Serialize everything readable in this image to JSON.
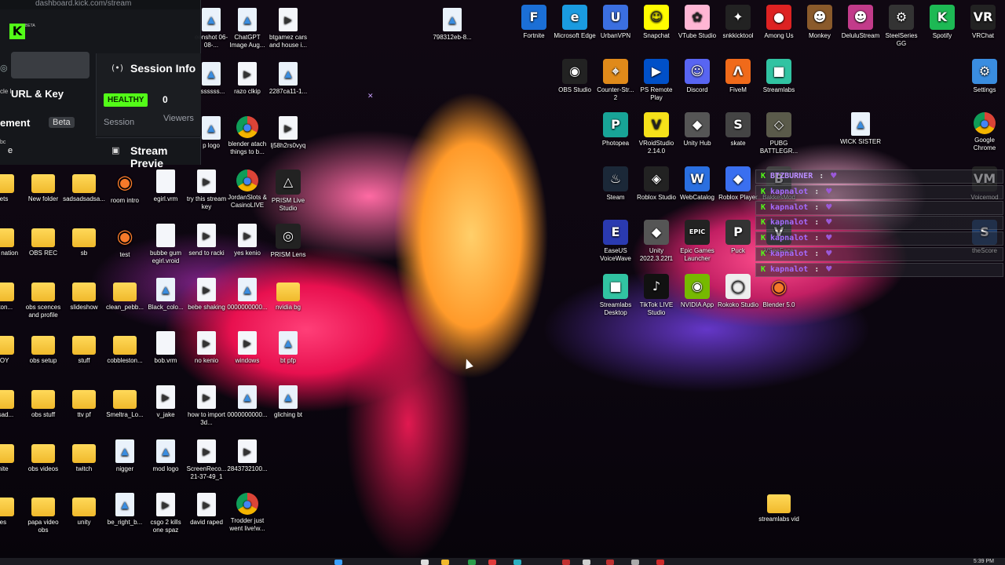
{
  "dashboard": {
    "url": "dashboard.kick.com/stream",
    "beta_tag": "BETA",
    "url_key_label": "URL & Key",
    "management_label": "ement",
    "beta_badge": "Beta",
    "left_fragment_1": "cle I",
    "left_fragment_2": "bc",
    "left_fragment_3": "e",
    "session_info_title": "Session Info",
    "status_badge": "HEALTHY",
    "session_label": "Session",
    "viewer_count": "0",
    "viewers_label": "Viewers",
    "stream_preview_title": "Stream Previe"
  },
  "desktop_icons": [
    {
      "label": "eenshot 06-08-...",
      "type": "img-file"
    },
    {
      "label": "ChatGPT Image Aug...",
      "type": "img-file"
    },
    {
      "label": "btgamez cars and house i...",
      "type": "video"
    },
    {
      "label": "798312eb-8...",
      "type": "img-file"
    },
    {
      "label": "sssssss...",
      "type": "img-file"
    },
    {
      "label": "razo clkip",
      "type": "video"
    },
    {
      "label": "2287ca11-1...",
      "type": "img-file"
    },
    {
      "label": "p logo",
      "type": "img-file"
    },
    {
      "label": "blender atach things to b...",
      "type": "chrome"
    },
    {
      "label": "lj58h2rs0vyq",
      "type": "video"
    },
    {
      "label": "sets",
      "type": "folder"
    },
    {
      "label": "New folder",
      "type": "folder"
    },
    {
      "label": "sadsadsadsa...",
      "type": "folder"
    },
    {
      "label": "room intro",
      "type": "blender"
    },
    {
      "label": "egirl.vrm",
      "type": "file"
    },
    {
      "label": "try this stream key",
      "type": "video"
    },
    {
      "label": "JordanSlots & CasinoLIVE",
      "type": "chrome"
    },
    {
      "label": "PRISM Live Studio",
      "type": "app"
    },
    {
      "label": "nder nation",
      "type": "folder"
    },
    {
      "label": "OBS REC",
      "type": "folder"
    },
    {
      "label": "sb",
      "type": "folder"
    },
    {
      "label": "test",
      "type": "blender"
    },
    {
      "label": "bubbe gum egirl.vroid",
      "type": "file"
    },
    {
      "label": "send to racki",
      "type": "video"
    },
    {
      "label": "yes kenio",
      "type": "video"
    },
    {
      "label": "PRISM Lens",
      "type": "app"
    },
    {
      "label": "eston...",
      "type": "folder"
    },
    {
      "label": "obs scences and profile",
      "type": "folder"
    },
    {
      "label": "slideshow",
      "type": "folder"
    },
    {
      "label": "clean_pebb...",
      "type": "folder"
    },
    {
      "label": "Black_colo...",
      "type": "img-file"
    },
    {
      "label": "bebe shaking",
      "type": "video"
    },
    {
      "label": "0000000000...",
      "type": "img-file"
    },
    {
      "label": "nvidia bg",
      "type": "folder"
    },
    {
      "label": "BOY",
      "type": "folder"
    },
    {
      "label": "obs setup",
      "type": "folder"
    },
    {
      "label": "stuff",
      "type": "folder"
    },
    {
      "label": "cobbleston...",
      "type": "folder"
    },
    {
      "label": "bob.vrm",
      "type": "file"
    },
    {
      "label": "no kenio",
      "type": "video"
    },
    {
      "label": "windows",
      "type": "video"
    },
    {
      "label": "bt pfp",
      "type": "img-file"
    },
    {
      "label": "adsad...",
      "type": "folder"
    },
    {
      "label": "obs stuff",
      "type": "folder"
    },
    {
      "label": "ttv pf",
      "type": "folder"
    },
    {
      "label": "Smeltra_Lo...",
      "type": "folder"
    },
    {
      "label": "v_jake",
      "type": "video"
    },
    {
      "label": "how to import 3d...",
      "type": "video"
    },
    {
      "label": "0000000000...",
      "type": "img-file"
    },
    {
      "label": "gliching bt",
      "type": "img-file"
    },
    {
      "label": "tnite",
      "type": "folder"
    },
    {
      "label": "obs videos",
      "type": "folder"
    },
    {
      "label": "twitch",
      "type": "folder"
    },
    {
      "label": "nigger",
      "type": "img-file"
    },
    {
      "label": "mod logo",
      "type": "img-file"
    },
    {
      "label": "ScreenReco... 21-37-49_1",
      "type": "video"
    },
    {
      "label": "2843732100...",
      "type": "video"
    },
    {
      "label": "ies",
      "type": "folder"
    },
    {
      "label": "papa video obs",
      "type": "folder"
    },
    {
      "label": "unity",
      "type": "folder"
    },
    {
      "label": "be_right_b...",
      "type": "img-file"
    },
    {
      "label": "csgo 2 kills one spaz",
      "type": "video"
    },
    {
      "label": "david raped",
      "type": "video"
    },
    {
      "label": "Trodder just went live!w...",
      "type": "chrome"
    },
    {
      "label": "Fortnite",
      "type": "app"
    },
    {
      "label": "Microsoft Edge",
      "type": "app"
    },
    {
      "label": "UrbanVPN",
      "type": "app"
    },
    {
      "label": "Snapchat",
      "type": "app"
    },
    {
      "label": "VTube Studio",
      "type": "app"
    },
    {
      "label": "snkkicktool",
      "type": "app"
    },
    {
      "label": "Among Us",
      "type": "app"
    },
    {
      "label": "Monkey",
      "type": "app"
    },
    {
      "label": "DeluluStream",
      "type": "app"
    },
    {
      "label": "SteelSeries GG",
      "type": "app"
    },
    {
      "label": "Spotify",
      "type": "app"
    },
    {
      "label": "VRChat",
      "type": "app"
    },
    {
      "label": "OBS Studio",
      "type": "app"
    },
    {
      "label": "Counter-Str... 2",
      "type": "app"
    },
    {
      "label": "PS Remote Play",
      "type": "app"
    },
    {
      "label": "Discord",
      "type": "app"
    },
    {
      "label": "FiveM",
      "type": "app"
    },
    {
      "label": "Streamlabs",
      "type": "app"
    },
    {
      "label": "Settings",
      "type": "app"
    },
    {
      "label": "Photopea",
      "type": "app"
    },
    {
      "label": "VRoidStudio 2.14.0",
      "type": "app"
    },
    {
      "label": "Unity Hub",
      "type": "app"
    },
    {
      "label": "skate",
      "type": "app"
    },
    {
      "label": "PUBG BATTLEGR...",
      "type": "app"
    },
    {
      "label": "WICK SISTER",
      "type": "img-file"
    },
    {
      "label": "Google Chrome",
      "type": "chrome"
    },
    {
      "label": "Steam",
      "type": "app"
    },
    {
      "label": "Roblox Studio",
      "type": "app"
    },
    {
      "label": "WebCatalog",
      "type": "app"
    },
    {
      "label": "Roblox Player",
      "type": "app"
    },
    {
      "label": "BakkesMod",
      "type": "app"
    },
    {
      "label": "Voicemod",
      "type": "app"
    },
    {
      "label": "EaseUS VoiceWave",
      "type": "app"
    },
    {
      "label": "Unity 2022.3.22f1",
      "type": "app"
    },
    {
      "label": "Epic Games Launcher",
      "type": "app"
    },
    {
      "label": "Puck",
      "type": "app"
    },
    {
      "label": "VSeeFace",
      "type": "app"
    },
    {
      "label": "theScore",
      "type": "app"
    },
    {
      "label": "Streamlabs Desktop",
      "type": "app"
    },
    {
      "label": "TikTok LIVE Studio",
      "type": "app"
    },
    {
      "label": "NVIDIA App",
      "type": "app"
    },
    {
      "label": "Rokoko Studio",
      "type": "app"
    },
    {
      "label": "Blender 5.0",
      "type": "blender"
    },
    {
      "label": "streamlabs vid",
      "type": "folder"
    }
  ],
  "chat_messages": [
    {
      "user": "BTZBURNER",
      "badge": "K"
    },
    {
      "user": "kapnalot",
      "badge": "K"
    },
    {
      "user": "kapnalot",
      "badge": "K"
    },
    {
      "user": "kapnalot",
      "badge": "K"
    },
    {
      "user": "kapnalot",
      "badge": "K"
    },
    {
      "user": "kapnalot",
      "badge": "K"
    },
    {
      "user": "kapnalot",
      "badge": "K"
    }
  ],
  "chat_separator": ":",
  "taskbar": {
    "clock": "5:39 PM"
  },
  "colors": {
    "kick_green": "#53fc18",
    "chat_name": "#a66bff",
    "folder_yellow": "#f0b92b",
    "background": "#0b0610"
  }
}
